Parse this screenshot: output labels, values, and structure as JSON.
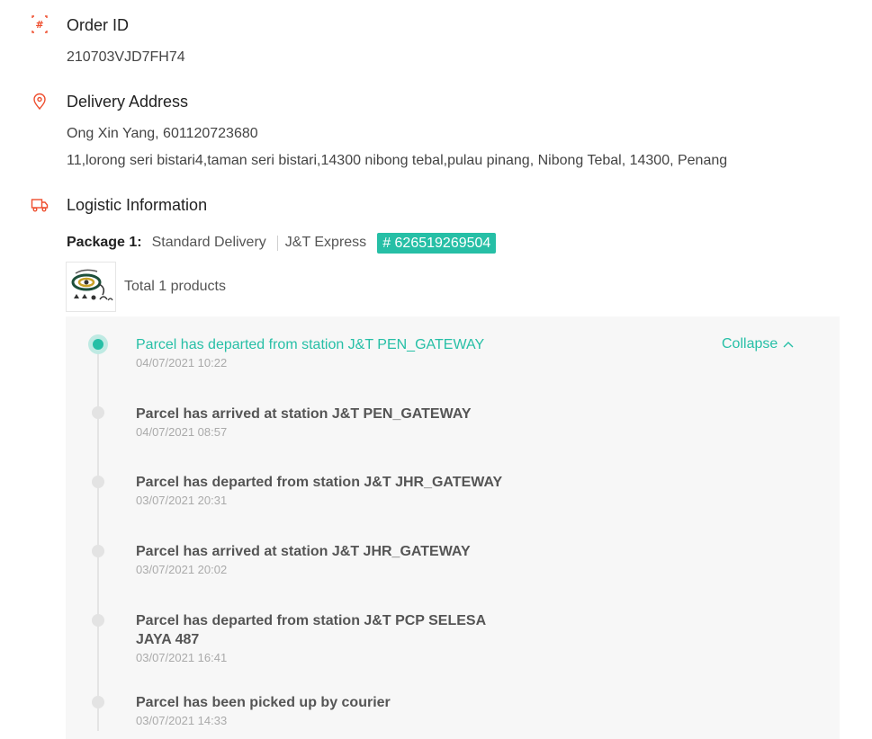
{
  "order": {
    "title": "Order ID",
    "icon": "hash-icon",
    "value": "210703VJD7FH74"
  },
  "address": {
    "title": "Delivery Address",
    "icon": "location-pin-icon",
    "name_phone": "Ong Xin Yang, 601120723680",
    "full_address": "11,lorong seri bistari4,taman seri bistari,14300 nibong tebal,pulau pinang, Nibong Tebal, 14300, Penang"
  },
  "logistic": {
    "title": "Logistic Information",
    "icon": "truck-icon",
    "package_label": "Package 1:",
    "service": "Standard Delivery",
    "courier": "J&T Express",
    "tracking_number": "# 626519269504",
    "products_count": "Total 1 products",
    "collapse_label": "Collapse",
    "events": [
      {
        "title": "Parcel has departed from station J&T PEN_GATEWAY",
        "time": "04/07/2021 10:22",
        "active": true
      },
      {
        "title": "Parcel has arrived at station J&T PEN_GATEWAY",
        "time": "04/07/2021 08:57"
      },
      {
        "title": "Parcel has departed from station J&T JHR_GATEWAY",
        "time": "03/07/2021 20:31"
      },
      {
        "title": "Parcel has arrived at station J&T JHR_GATEWAY",
        "time": "03/07/2021 20:02"
      },
      {
        "title": "Parcel has departed from station J&T PCP SELESA JAYA 487",
        "time": "03/07/2021 16:41"
      },
      {
        "title": "Parcel has been picked up by courier",
        "time": "03/07/2021 14:33"
      }
    ]
  },
  "colors": {
    "accent": "#26bfa6",
    "icon_red": "#ee4d2d",
    "panel_bg": "#f7f7f7"
  }
}
